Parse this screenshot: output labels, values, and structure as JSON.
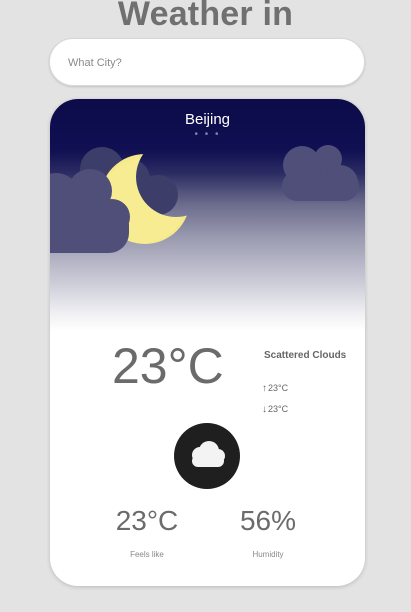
{
  "header": {
    "title": "Weather in"
  },
  "search": {
    "placeholder": "What City?",
    "value": ""
  },
  "card": {
    "city": "Beijing",
    "dots": "• • •",
    "temperature": "23°C",
    "description": "Scattered Clouds",
    "temp_max": "23°C",
    "temp_min": "23°C",
    "arrow_up": "↑",
    "arrow_down": "↓",
    "condition_icon": "cloud-icon",
    "scene_icon": "moon-with-clouds-icon",
    "feels_like_value": "23°C",
    "feels_like_label": "Feels like",
    "humidity_value": "56%",
    "humidity_label": "Humidity"
  },
  "colors": {
    "page_background": "#e3e3e3",
    "sky_top": "#0c0c4a",
    "moon": "#f6e98a",
    "cloud_dark": "#4f4f7a",
    "icon_circle": "#1f1f1f"
  }
}
